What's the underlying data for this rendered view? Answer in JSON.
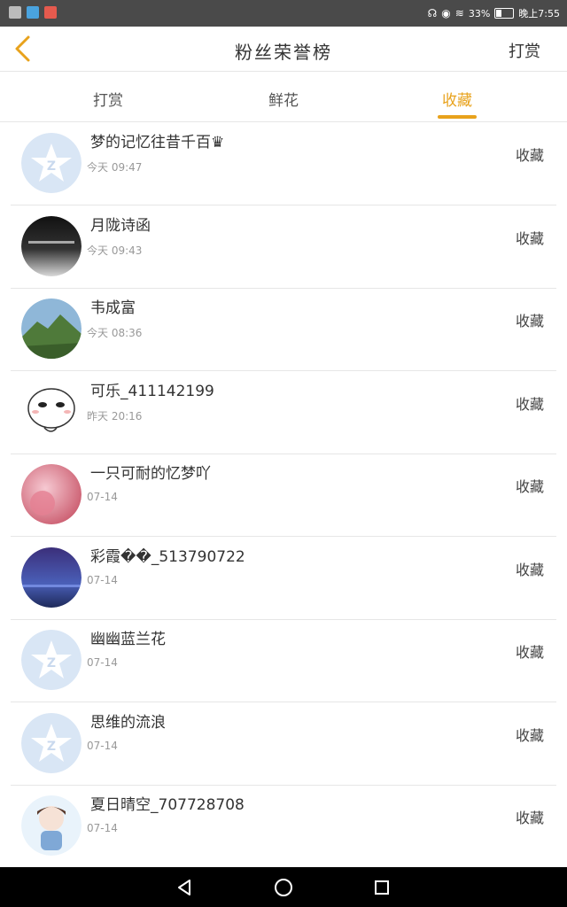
{
  "status_bar": {
    "battery": "33",
    "time": "晚上7:55",
    "battery_level": 0.33
  },
  "header": {
    "title": "粉丝荣誉榜",
    "right_action": "打赏"
  },
  "tabs": [
    {
      "label": "打赏",
      "active": false
    },
    {
      "label": "鲜花",
      "active": false
    },
    {
      "label": "收藏",
      "active": true
    }
  ],
  "colors": {
    "accent": "#e8a21c",
    "divider": "#e6e6e6",
    "default_avatar": "#d9e6f5"
  },
  "list": [
    {
      "name": "梦的记忆往昔千百♛",
      "time": "今天 09:47",
      "action": "收藏",
      "avatar": "default-avatar"
    },
    {
      "name": "月陇诗函",
      "time": "今天 09:43",
      "action": "收藏",
      "avatar": "misty-landscape-avatar"
    },
    {
      "name": "韦成富",
      "time": "今天 08:36",
      "action": "收藏",
      "avatar": "mountain-avatar"
    },
    {
      "name": "可乐_411142199",
      "time": "昨天 20:16",
      "action": "收藏",
      "avatar": "cartoon-face-avatar"
    },
    {
      "name": "一只可耐的忆梦吖",
      "time": "07-14",
      "action": "收藏",
      "avatar": "pink-girl-avatar"
    },
    {
      "name": "彩霞��_513790722",
      "time": "07-14",
      "action": "收藏",
      "avatar": "night-sky-avatar"
    },
    {
      "name": "幽幽蓝兰花",
      "time": "07-14",
      "action": "收藏",
      "avatar": "default-avatar"
    },
    {
      "name": "思维的流浪",
      "time": "07-14",
      "action": "收藏",
      "avatar": "default-avatar"
    },
    {
      "name": "夏日晴空_707728708",
      "time": "07-14",
      "action": "收藏",
      "avatar": "anime-boy-avatar"
    }
  ]
}
